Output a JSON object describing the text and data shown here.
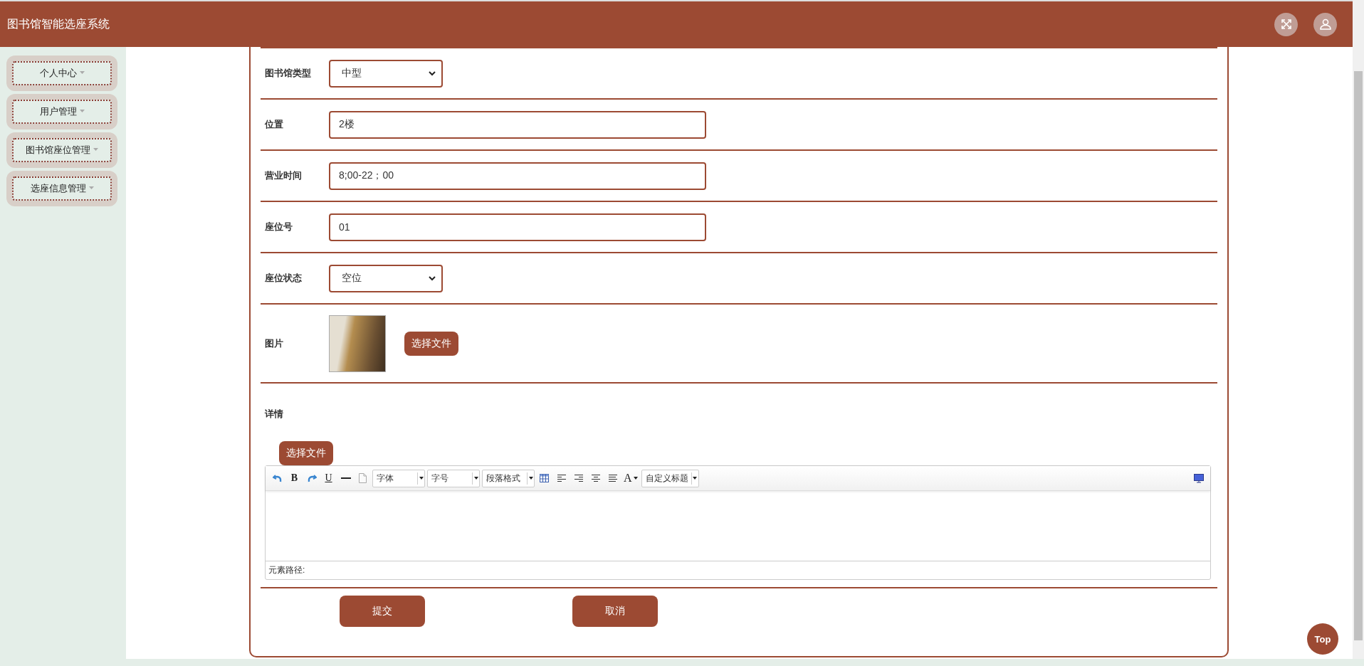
{
  "header": {
    "title": "图书馆智能选座系统"
  },
  "sidebar": {
    "items": [
      {
        "label": "个人中心"
      },
      {
        "label": "用户管理"
      },
      {
        "label": "图书馆座位管理"
      },
      {
        "label": "选座信息管理"
      }
    ]
  },
  "form": {
    "fields": [
      {
        "kind": "select",
        "label": "图书馆类型",
        "value": "中型"
      },
      {
        "kind": "text",
        "label": "位置",
        "value": "2楼"
      },
      {
        "kind": "text",
        "label": "营业时间",
        "value": "8;00-22；00"
      },
      {
        "kind": "text",
        "label": "座位号",
        "value": "01"
      },
      {
        "kind": "select",
        "label": "座位状态",
        "value": "空位"
      },
      {
        "kind": "image",
        "label": "图片",
        "button": "选择文件"
      }
    ],
    "details": {
      "label": "详情",
      "upload_button": "选择文件",
      "toolbar": [
        {
          "kind": "undo"
        },
        {
          "kind": "bold",
          "label": "B"
        },
        {
          "kind": "redo"
        },
        {
          "kind": "underline",
          "label": "U"
        },
        {
          "kind": "rule"
        },
        {
          "kind": "page"
        },
        {
          "kind": "dropdown",
          "label": "字体"
        },
        {
          "kind": "dropdown",
          "label": "字号"
        },
        {
          "kind": "dropdown",
          "label": "段落格式"
        },
        {
          "kind": "table"
        },
        {
          "kind": "left"
        },
        {
          "kind": "right"
        },
        {
          "kind": "center"
        },
        {
          "kind": "justify"
        },
        {
          "kind": "fontcolor",
          "label": "A"
        },
        {
          "kind": "dropdown",
          "label": "自定义标题"
        },
        {
          "kind": "preview"
        }
      ],
      "status": "元素路径:"
    },
    "buttons": [
      "提交",
      "取消"
    ]
  },
  "top_button": "Top"
}
